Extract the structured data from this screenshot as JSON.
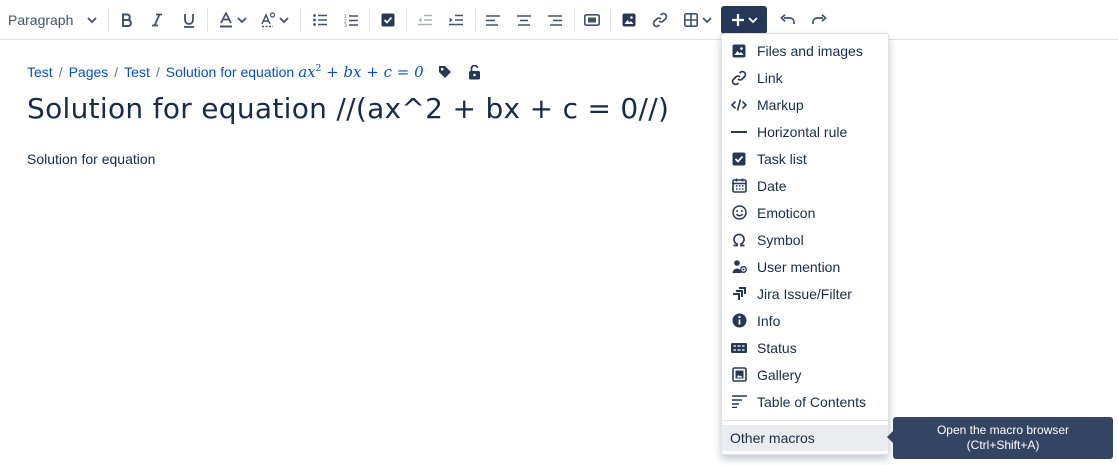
{
  "toolbar": {
    "paragraph_label": "Paragraph"
  },
  "breadcrumb": {
    "items": [
      "Test",
      "Pages",
      "Test",
      "Solution for equation"
    ],
    "math": {
      "a": "ax",
      "exp": "2",
      "rest": " + bx + c = 0"
    }
  },
  "page": {
    "title": "Solution for equation //(ax^2 + bx + c = 0//)",
    "body": "Solution for equation"
  },
  "insert_menu": {
    "items": [
      {
        "label": "Files and images",
        "icon": "image-icon"
      },
      {
        "label": "Link",
        "icon": "link-icon"
      },
      {
        "label": "Markup",
        "icon": "markup-icon"
      },
      {
        "label": "Horizontal rule",
        "icon": "horizontal-rule-icon"
      },
      {
        "label": "Task list",
        "icon": "task-list-icon"
      },
      {
        "label": "Date",
        "icon": "calendar-icon"
      },
      {
        "label": "Emoticon",
        "icon": "emoticon-icon"
      },
      {
        "label": "Symbol",
        "icon": "omega-icon"
      },
      {
        "label": "User mention",
        "icon": "user-mention-icon"
      },
      {
        "label": "Jira Issue/Filter",
        "icon": "jira-icon"
      },
      {
        "label": "Info",
        "icon": "info-icon"
      },
      {
        "label": "Status",
        "icon": "status-icon"
      },
      {
        "label": "Gallery",
        "icon": "gallery-icon"
      },
      {
        "label": "Table of Contents",
        "icon": "table-of-contents-icon"
      }
    ],
    "other_macros": "Other macros"
  },
  "tooltip": {
    "line1": "Open the macro browser",
    "line2": "(Ctrl+Shift+A)"
  },
  "colors": {
    "link": "#0052cc",
    "insert_button": "#253858",
    "tooltip_bg": "#344563",
    "text": "#172b4d"
  }
}
